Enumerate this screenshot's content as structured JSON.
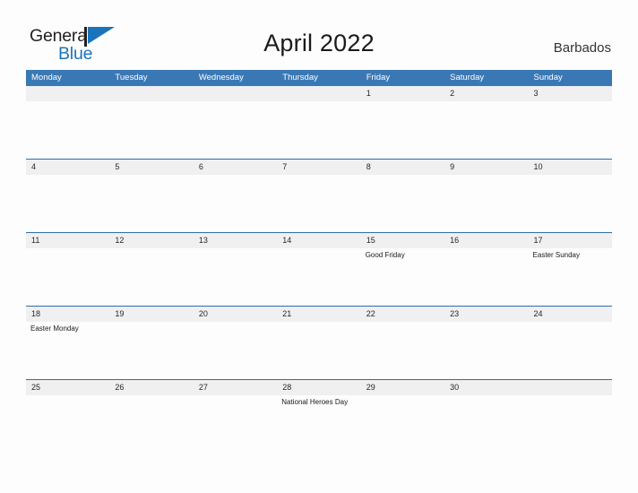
{
  "brand": {
    "name_part1": "General",
    "name_part2": "Blue",
    "flag_icon": "flag-triangle-icon",
    "color_primary": "#1b74bb",
    "color_text": "#231f20"
  },
  "header": {
    "title": "April 2022",
    "country": "Barbados"
  },
  "calendar": {
    "header_bg": "#3a78b5",
    "header_text_color": "#ffffff",
    "date_row_bg": "#f0f0f0",
    "row_divider_color": "#2f6ea8",
    "weekday_headers": [
      "Monday",
      "Tuesday",
      "Wednesday",
      "Thursday",
      "Friday",
      "Saturday",
      "Sunday"
    ],
    "weeks": [
      {
        "dates": [
          "",
          "",
          "",
          "",
          "1",
          "2",
          "3"
        ],
        "events": [
          "",
          "",
          "",
          "",
          "",
          "",
          ""
        ]
      },
      {
        "dates": [
          "4",
          "5",
          "6",
          "7",
          "8",
          "9",
          "10"
        ],
        "events": [
          "",
          "",
          "",
          "",
          "",
          "",
          ""
        ]
      },
      {
        "dates": [
          "11",
          "12",
          "13",
          "14",
          "15",
          "16",
          "17"
        ],
        "events": [
          "",
          "",
          "",
          "",
          "Good Friday",
          "",
          "Easter Sunday"
        ]
      },
      {
        "dates": [
          "18",
          "19",
          "20",
          "21",
          "22",
          "23",
          "24"
        ],
        "events": [
          "Easter Monday",
          "",
          "",
          "",
          "",
          "",
          ""
        ]
      },
      {
        "dates": [
          "25",
          "26",
          "27",
          "28",
          "29",
          "30",
          ""
        ],
        "events": [
          "",
          "",
          "",
          "National Heroes Day",
          "",
          "",
          ""
        ]
      }
    ]
  }
}
